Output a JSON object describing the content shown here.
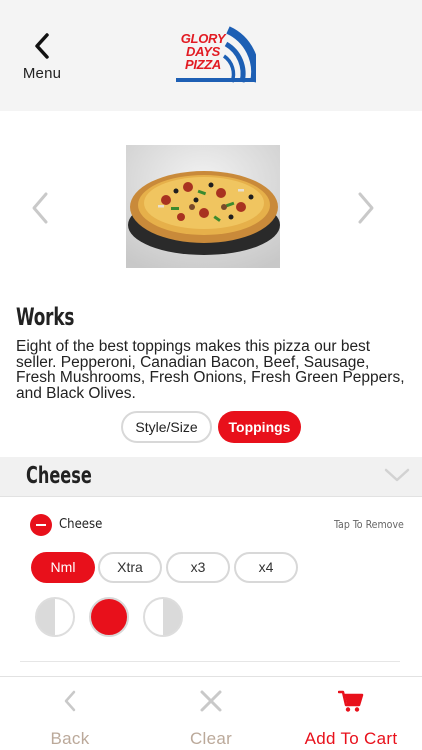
{
  "header": {
    "menu_label": "Menu",
    "logo_lines": [
      "GLORY",
      "DAYS",
      "PIZZA"
    ]
  },
  "product": {
    "name": "Works",
    "description": "Eight of the best toppings makes this pizza our best seller.  Pepperoni, Canadian Bacon, Beef, Sausage, Fresh Mushrooms, Fresh Onions, Fresh Green Peppers, and Black Olives."
  },
  "tabs": {
    "style_size": "Style/Size",
    "toppings": "Toppings",
    "selected": "Toppings"
  },
  "section": {
    "title": "Cheese"
  },
  "topping": {
    "name": "Cheese",
    "hint": "Tap To Remove",
    "amounts": [
      "Nml",
      "Xtra",
      "x3",
      "x4"
    ],
    "selected_amount": "Nml",
    "coverage_options": [
      "left-half",
      "whole",
      "right-half"
    ],
    "selected_coverage": "whole"
  },
  "bottom_nav": {
    "back": "Back",
    "clear": "Clear",
    "add_to_cart": "Add To Cart"
  },
  "colors": {
    "accent": "#e8101b",
    "logo_blue": "#1d5fb4",
    "muted_label": "#bba99a"
  }
}
